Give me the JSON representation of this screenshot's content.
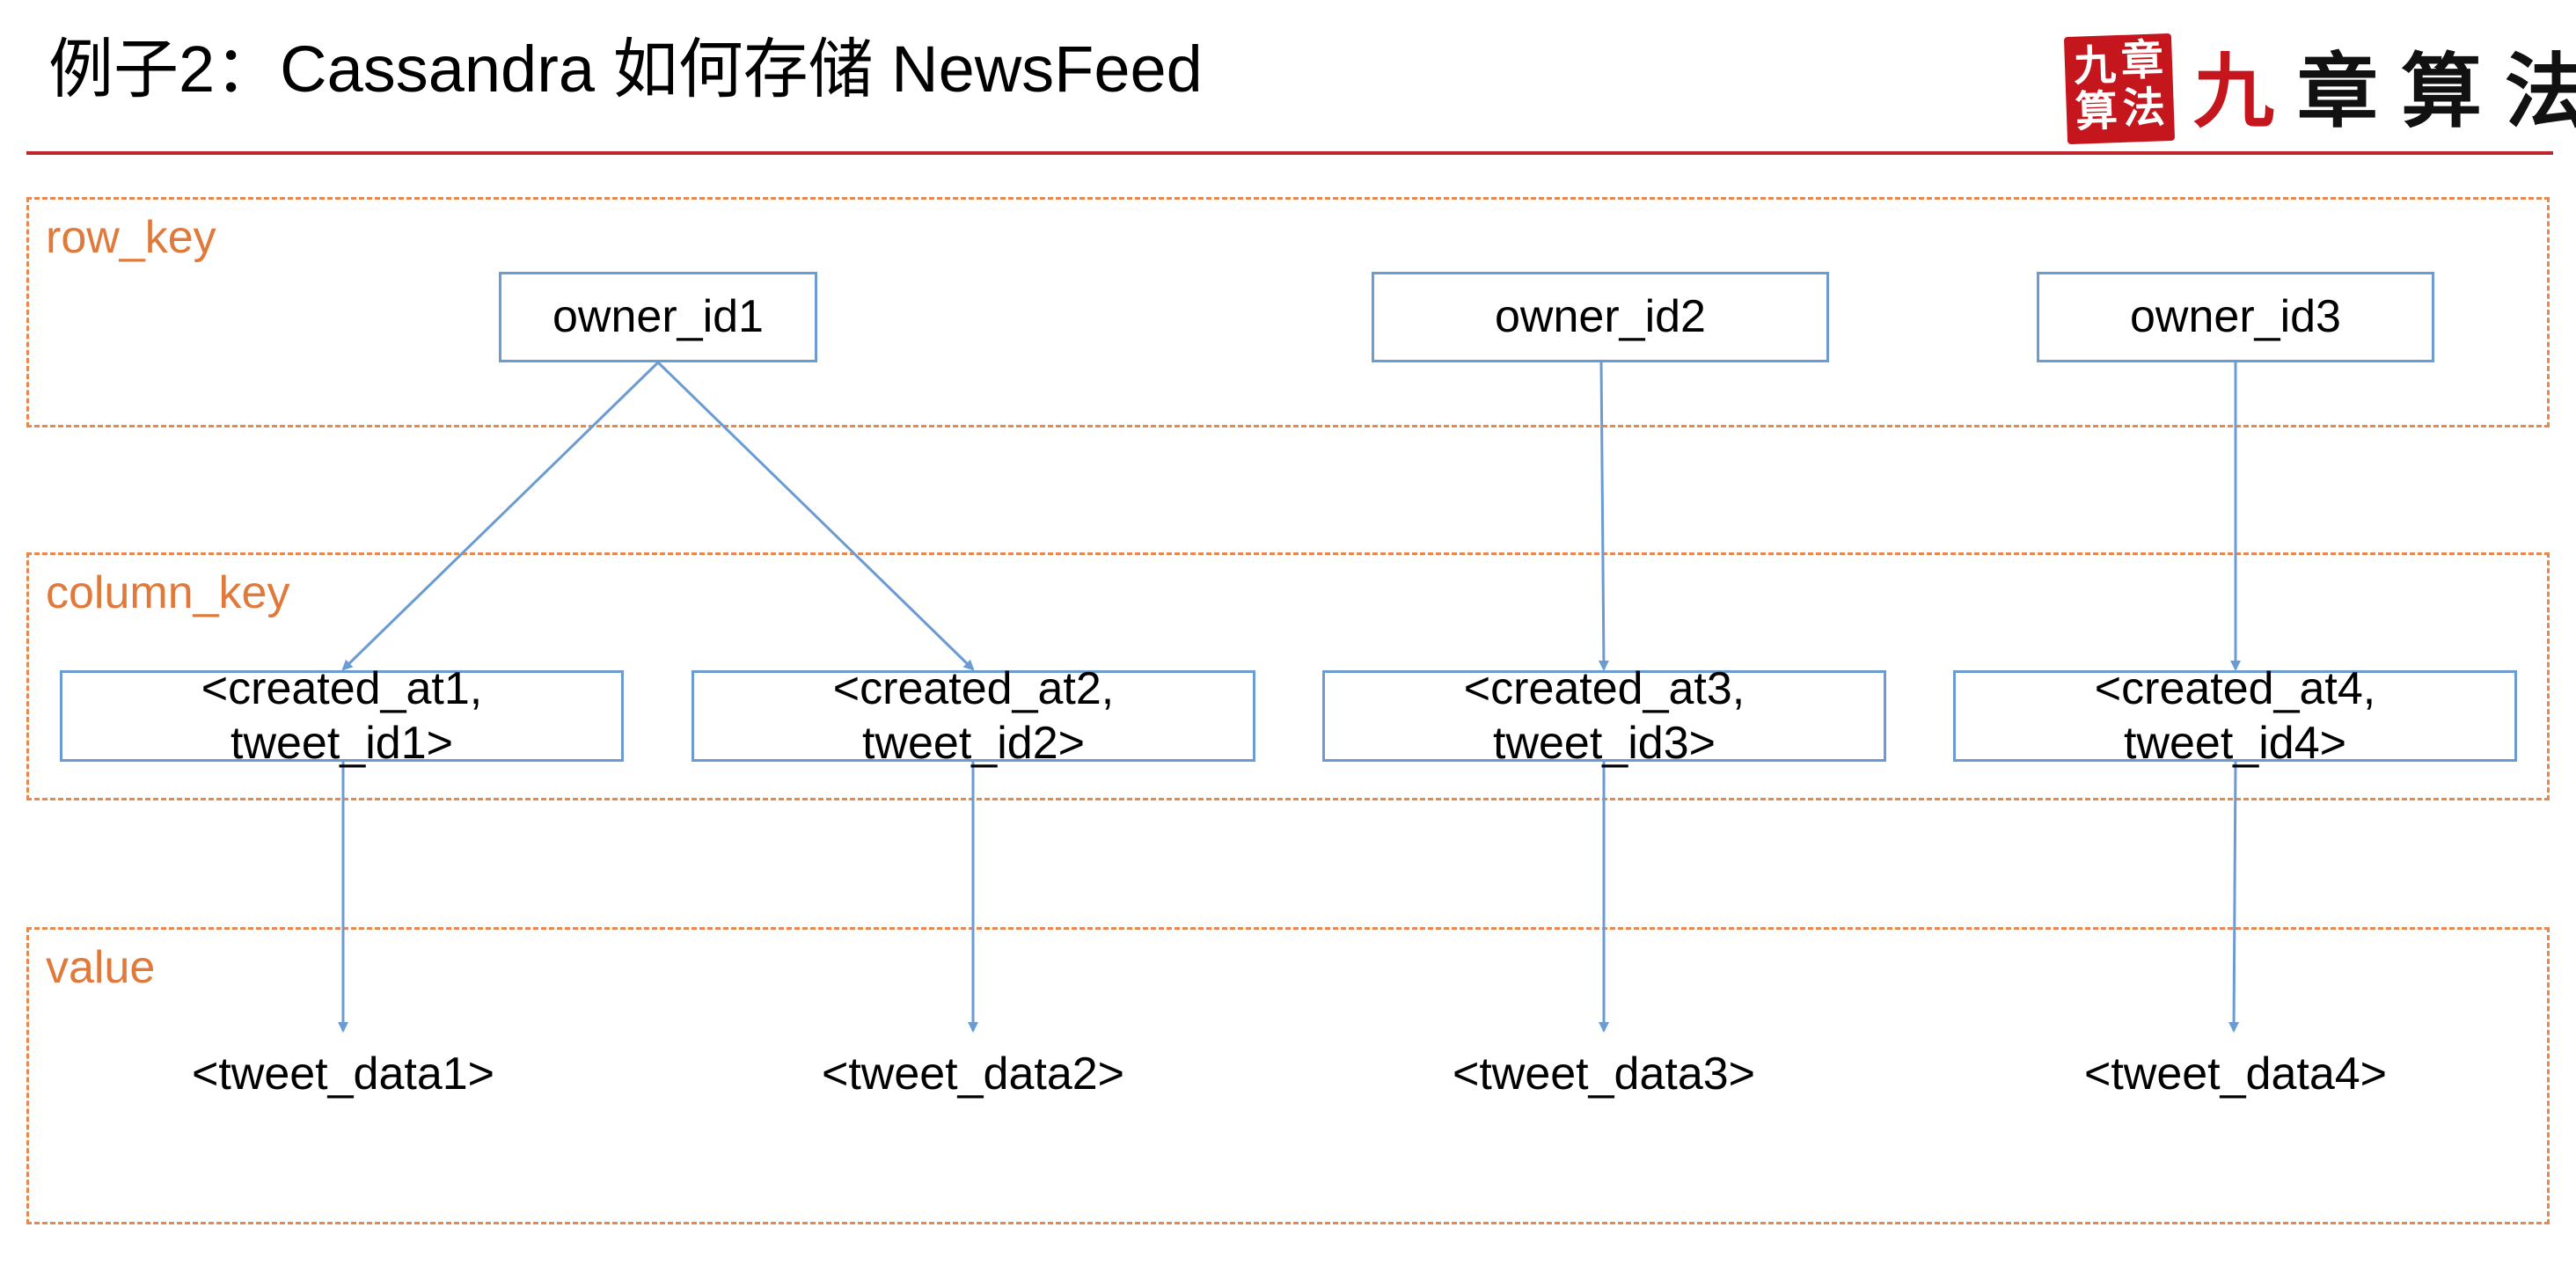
{
  "header": {
    "title": "例子2：Cassandra 如何存储 NewsFeed",
    "logo": {
      "seal_chars": [
        "九",
        "章",
        "算",
        "法"
      ],
      "wordmark_first": "九",
      "wordmark_rest": "章算法"
    }
  },
  "sections": {
    "row_key": "row_key",
    "column_key": "column_key",
    "value": "value"
  },
  "row_keys": [
    "owner_id1",
    "owner_id2",
    "owner_id3"
  ],
  "column_keys": [
    "<created_at1,\ntweet_id1>",
    "<created_at2,\ntweet_id2>",
    "<created_at3,\ntweet_id3>",
    "<created_at4,\ntweet_id4>"
  ],
  "values": [
    "<tweet_data1>",
    "<tweet_data2>",
    "<tweet_data3>",
    "<tweet_data4>"
  ],
  "colors": {
    "accent_rule": "#c0262c",
    "section_border": "#e8884e",
    "section_label": "#e07a3c",
    "box_border": "#6a9bd2",
    "arrow": "#6a9bd2"
  }
}
